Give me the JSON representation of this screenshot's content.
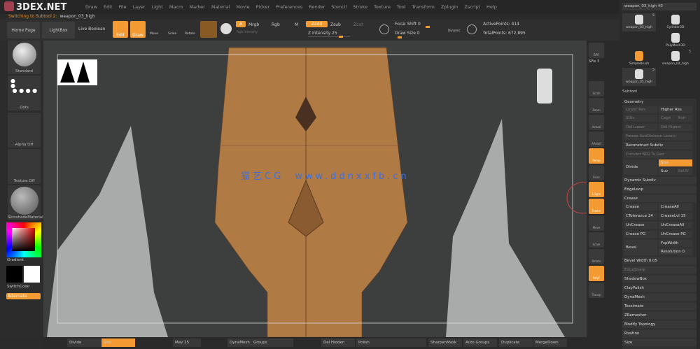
{
  "brand": "3DEX.NET",
  "menu": [
    "Alpha",
    "Brush",
    "Color",
    "Document",
    "Draw",
    "Edit",
    "File",
    "Layer",
    "Light",
    "Macro",
    "Marker",
    "Material",
    "Movie",
    "Picker",
    "Preferences",
    "Render",
    "Stencil",
    "Stroke",
    "Texture",
    "Tool",
    "Transform",
    "Zplugin",
    "Zscript",
    "Help"
  ],
  "subtitle": {
    "label": "Switching to Subtool 2:",
    "tool": "weapon_03_high"
  },
  "top": {
    "home": "Home Page",
    "lightbox": "LightBox",
    "live_boolean": "Live Boolean",
    "edit": "Edit",
    "draw": "Draw",
    "move": "Move",
    "scale": "Scale",
    "rotate": "Rotate",
    "a": "A",
    "mrgb": "Mrgb",
    "rgb": "Rgb",
    "m": "M",
    "zadd": "Zadd",
    "zsub": "Zsub",
    "zcut": "Zcut",
    "rgb_intensity": "Rgb Intensity",
    "z_intensity": "Z Intensity 25",
    "focal_shift": "Focal Shift 0",
    "draw_size": "Draw Size 0",
    "dynamic": "Dynamic",
    "active_points": "ActivePoints: 414",
    "total_points": "TotalPoints: 672,895"
  },
  "left": {
    "brush": "Standard",
    "stroke": "Dots",
    "alpha": "Alpha Off",
    "texture": "Texture Off",
    "material": "SkinshadeMaterial",
    "gradient": "Gradient",
    "switch": "SwitchColor",
    "alternate": "Alternate"
  },
  "watermark": "猫艺CG  www.ddnxxfb.cn",
  "shelf": [
    "BPR",
    "SPix 3",
    "Scroll",
    "Zoom",
    "Actual",
    "AAHalf",
    "Persp",
    "Floor",
    "L.Sym",
    "Frame",
    "Move",
    "Scale",
    "Rotate",
    "PolyF",
    "Transp"
  ],
  "spix": "SPix 3",
  "tools": {
    "current": "weapon_03_high  40",
    "items": [
      {
        "name": "weapon_03_high",
        "count": "5"
      },
      {
        "name": "Cylinder3D"
      },
      {
        "name": "PolyMesh3D"
      },
      {
        "name": "SimpleBrush"
      },
      {
        "name": "weapon_04_high",
        "count": "5"
      },
      {
        "name": "weapon_05_high",
        "count": "5"
      }
    ]
  },
  "subtool": {
    "title": "Subtool",
    "geometry": "Geometry",
    "lower_res": "Lower Res",
    "higher_res": "Higher Res",
    "sdiv": "SDiv",
    "cage": "Cage",
    "rstr": "Rstr",
    "del_lower": "Del Lower",
    "del_higher": "Del Higher",
    "freeze": "Freeze SubDivision Levels",
    "reconstruct": "Reconstruct Subdiv",
    "convert": "Convert BPR To Geo",
    "divide": "Divide",
    "smt": "Smt",
    "suv": "Suv",
    "reuv": "ReUV",
    "dynamic_subdiv": "Dynamic Subdiv",
    "edgeloop": "EdgeLoop",
    "crease": "Crease",
    "crease_btn": "Crease",
    "crease_all": "CreaseAll",
    "ctolerance": "CTolerance 24",
    "crease_lvl": "CreaseLvl 15",
    "uncrease": "UnCrease",
    "uncrease_all": "UnCreaseAll",
    "crease_pg": "Crease PG",
    "uncrease_pg": "UnCrease PG",
    "bevel": "Bevel",
    "fsp_width": "FspWidth",
    "resolution": "Resolution 0",
    "bevel_width": "Bevel Width 0.05",
    "edge_sharp": "EdgeSharp",
    "sections": [
      "ShadowBox",
      "ClayPolish",
      "DynaMesh",
      "Tessimate",
      "ZRemesher",
      "Modify Topology",
      "Position",
      "Size"
    ]
  },
  "bottom": {
    "divide": "Divide",
    "smt": "Smt",
    "mav": "Mav 25",
    "dynamesh": "DynaMesh",
    "groups": "Groups",
    "del_hidden": "Del Hidden",
    "polish": "Polish",
    "sharpen_mask": "SharpenMask",
    "auto_groups": "Auto Groups",
    "duplicate": "Duplicate",
    "merge_down": "MergeDown"
  },
  "colors": {
    "accent": "#f39a32",
    "mesh": "#b07a45",
    "viewport": "#3d3e3e",
    "watermark": "#3a6fe0"
  }
}
